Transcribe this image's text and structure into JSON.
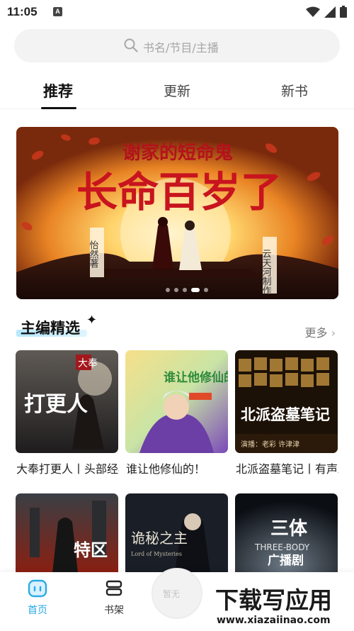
{
  "status": {
    "time": "11:05",
    "notif_letter": "A"
  },
  "search": {
    "placeholder": "书名/节目/主播"
  },
  "tabs": [
    {
      "label": "推荐",
      "active": true
    },
    {
      "label": "更新",
      "active": false
    },
    {
      "label": "新书",
      "active": false
    }
  ],
  "banner": {
    "subtitle": "谢家的短命鬼",
    "title": "长命百岁了",
    "author_tag": "怡然著",
    "producer_tag": "云天河制作",
    "dots": 5,
    "active_dot": 4
  },
  "section": {
    "title": "主编精选",
    "more": "更多"
  },
  "cards_row1": [
    {
      "title": "大奉打更人丨头部经典",
      "cover_text": "打更人",
      "cover_badge": "大奉"
    },
    {
      "title": "谁让他修仙的！",
      "cover_text": "谁让他修仙的！"
    },
    {
      "title": "北派盗墓笔记丨有声剧",
      "cover_text": "北派盗墓笔记",
      "cover_caption": "演播：老彩 许津津"
    }
  ],
  "cards_row2": [
    {
      "cover_text": "特区"
    },
    {
      "cover_text": "诡秘之主",
      "cover_en": "Lord of Mysteries"
    },
    {
      "cover_text": "三体",
      "cover_en": "THREE-BODY",
      "cover_sub": "广播剧"
    }
  ],
  "nav": {
    "home": "首页",
    "shelf": "书架",
    "player_hint": "暂无"
  },
  "watermark": {
    "cn": "下载写应用",
    "url": "www.xiazaiinao.com"
  },
  "colors": {
    "accent": "#29a9e6",
    "banner_red": "#c8141e"
  }
}
